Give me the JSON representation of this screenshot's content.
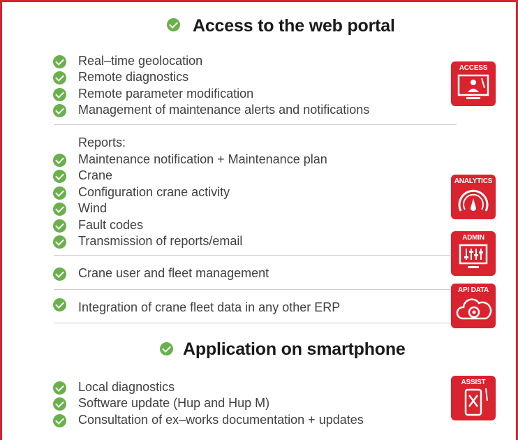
{
  "web_portal": {
    "title": "Access to the web portal",
    "group1": [
      "Real–time geolocation",
      "Remote diagnostics",
      "Remote parameter modification",
      "Management of maintenance alerts and notifications"
    ],
    "reports_label": "Reports:",
    "group2": [
      "Maintenance notification + Maintenance plan",
      "Crane",
      "Configuration crane activity",
      "Wind",
      "Fault codes",
      "Transmission of reports/email"
    ],
    "fleet_item": "Crane user and fleet management",
    "erp_item": "Integration of crane fleet data in any other ERP"
  },
  "smartphone": {
    "title": "Application on smartphone",
    "items": [
      "Local diagnostics",
      "Software update (Hup and Hup M)",
      "Consultation of ex–works documentation + updates"
    ]
  },
  "badges": {
    "access": "ACCESS",
    "analytics": "ANALYTICS",
    "admin": "ADMIN",
    "api_data": "API DATA",
    "assist": "ASSIST"
  },
  "colors": {
    "brand_red": "#d9232e",
    "check_green": "#6ab04c"
  }
}
